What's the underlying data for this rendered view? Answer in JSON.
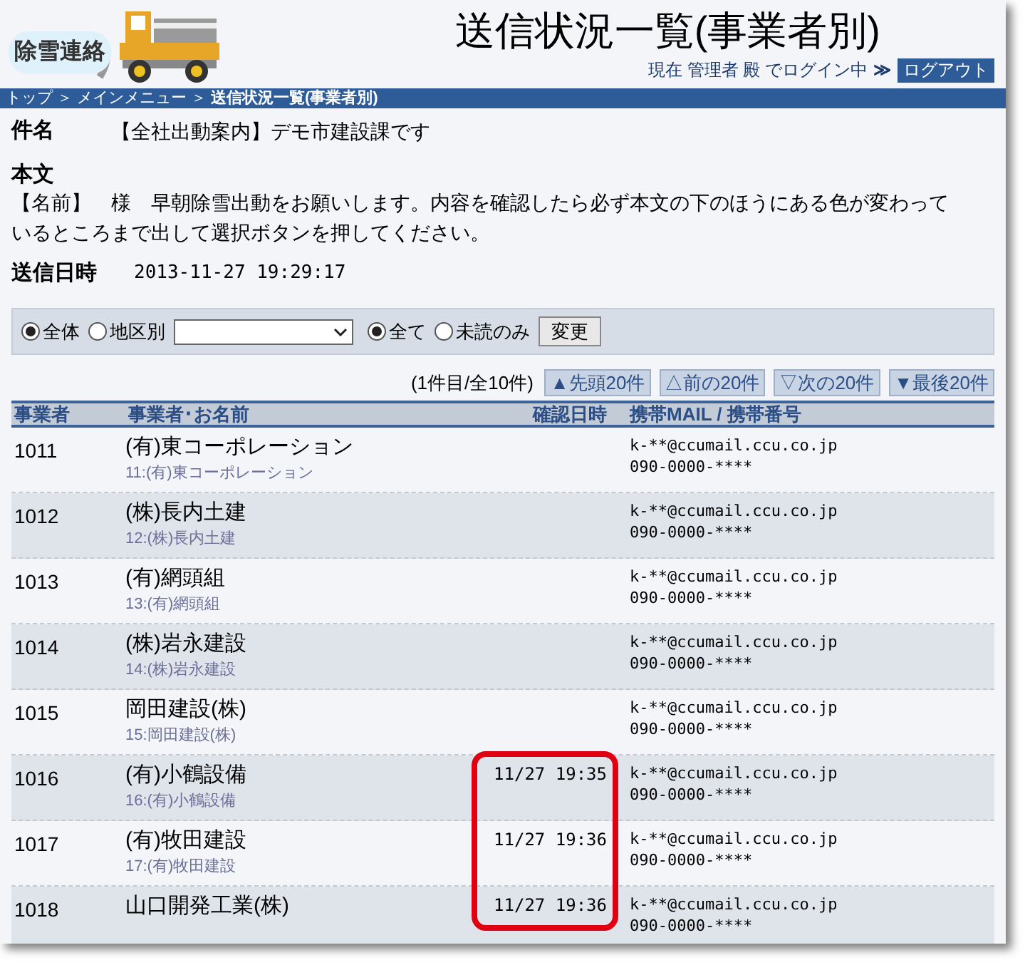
{
  "logo": {
    "text": "除雪連絡"
  },
  "title": "送信状況一覧(事業者別)",
  "login": {
    "text": "現在 管理者 殿 でログイン中",
    "arrow": "≫",
    "logout": "ログアウト"
  },
  "breadcrumb": [
    {
      "label": "トップ",
      "current": false
    },
    {
      "label": "メインメニュー",
      "current": false
    },
    {
      "label": "送信状況一覧(事業者別)",
      "current": true
    }
  ],
  "breadcrumb_separator": "＞",
  "subject": {
    "label": "件名",
    "value": "【全社出動案内】デモ市建設課です"
  },
  "body": {
    "label": "本文",
    "value": "【名前】　様　早朝除雪出動をお願いします。内容を確認したら必ず本文の下のほうにある色が変わっているところまで出して選択ボタンを押してください。"
  },
  "sent": {
    "label": "送信日時",
    "value": "2013-11-27 19:29:17"
  },
  "filter": {
    "scope": [
      {
        "label": "全体",
        "selected": true
      },
      {
        "label": "地区別",
        "selected": false
      }
    ],
    "status": [
      {
        "label": "全て",
        "selected": true
      },
      {
        "label": "未読のみ",
        "selected": false
      }
    ],
    "button": "変更"
  },
  "pagination": {
    "count": "(1件目/全10件)",
    "buttons": [
      "▲先頭20件",
      "△前の20件",
      "▽次の20件",
      "▼最後20件"
    ]
  },
  "table": {
    "columns": [
      "事業者",
      "事業者･お名前",
      "確認日時",
      "携帯MAIL / 携帯番号"
    ],
    "rows": [
      {
        "id": "1011",
        "name": "(有)東コーポレーション",
        "sub": "11:(有)東コーポレーション",
        "mail": "k-**@ccumail.ccu.co.jp",
        "phone": "090-0000-****"
      },
      {
        "id": "1012",
        "name": "(株)長内土建",
        "sub": "12:(株)長内土建",
        "mail": "k-**@ccumail.ccu.co.jp",
        "phone": "090-0000-****"
      },
      {
        "id": "1013",
        "name": "(有)網頭組",
        "sub": "13:(有)網頭組",
        "mail": "k-**@ccumail.ccu.co.jp",
        "phone": "090-0000-****"
      },
      {
        "id": "1014",
        "name": "(株)岩永建設",
        "sub": "14:(株)岩永建設",
        "mail": "k-**@ccumail.ccu.co.jp",
        "phone": "090-0000-****"
      },
      {
        "id": "1015",
        "name": "岡田建設(株)",
        "sub": "15:岡田建設(株)",
        "mail": "k-**@ccumail.ccu.co.jp",
        "phone": "090-0000-****"
      },
      {
        "id": "1016",
        "name": "(有)小鶴設備",
        "sub": "16:(有)小鶴設備",
        "time": "11/27 19:35",
        "mail": "k-**@ccumail.ccu.co.jp",
        "phone": "090-0000-****"
      },
      {
        "id": "1017",
        "name": "(有)牧田建設",
        "sub": "17:(有)牧田建設",
        "time": "11/27 19:36",
        "mail": "k-**@ccumail.ccu.co.jp",
        "phone": "090-0000-****"
      },
      {
        "id": "1018",
        "name": "山口開発工業(株)",
        "time": "11/27 19:36",
        "mail": "k-**@ccumail.ccu.co.jp",
        "phone": "090-0000-****"
      }
    ]
  }
}
